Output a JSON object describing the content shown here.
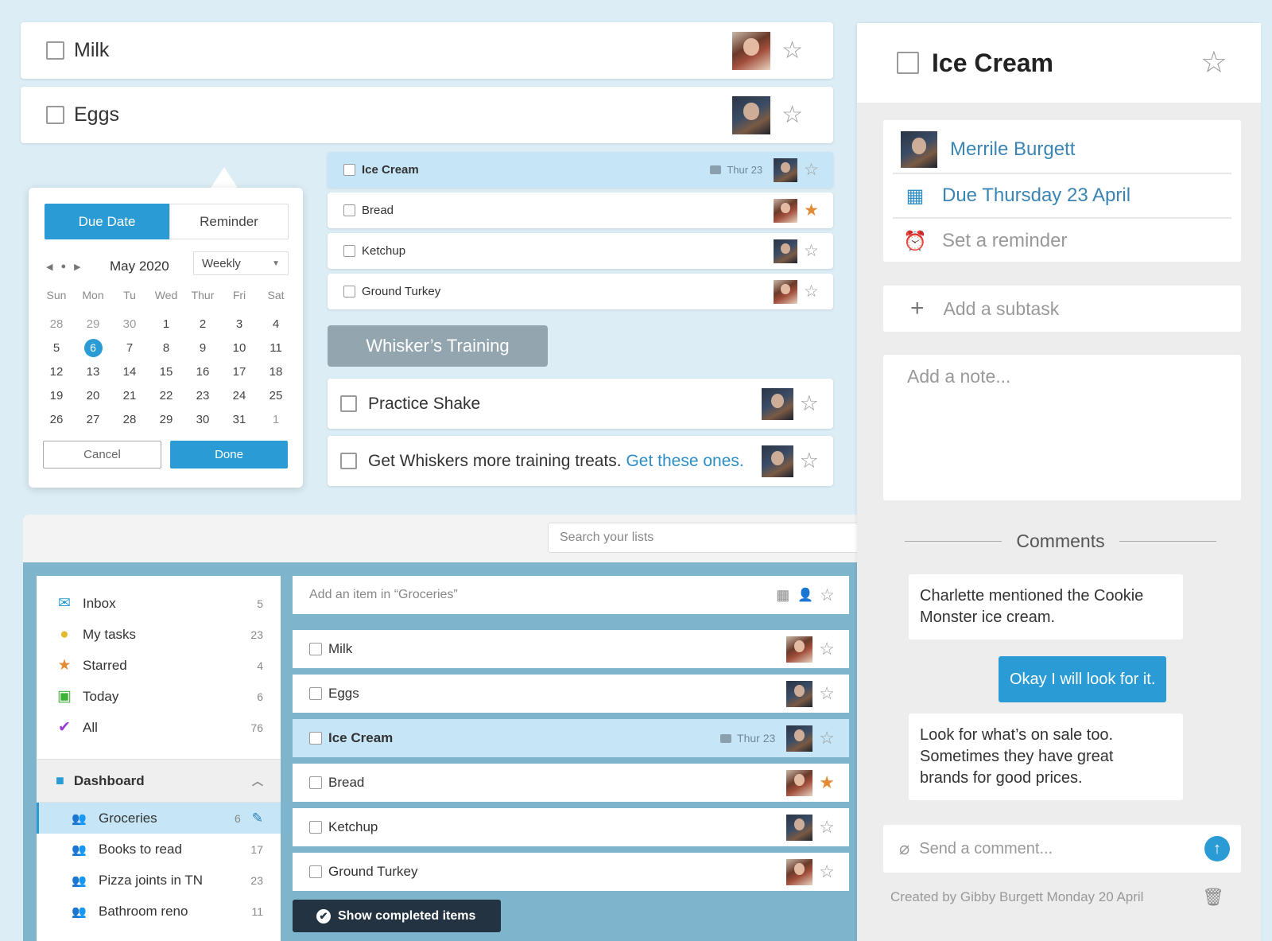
{
  "top_tasks": [
    {
      "label": "Milk",
      "assignee": "female",
      "starred": false
    },
    {
      "label": "Eggs",
      "assignee": "male",
      "starred": false
    }
  ],
  "mid_list": [
    {
      "label": "Ice Cream",
      "selected": true,
      "bold": true,
      "due": "Thur 23",
      "has_comment": true,
      "assignee": "male",
      "starred": false
    },
    {
      "label": "Bread",
      "assignee": "female",
      "starred": true
    },
    {
      "label": "Ketchup",
      "assignee": "male",
      "starred": false
    },
    {
      "label": "Ground Turkey",
      "assignee": "female",
      "starred": false
    }
  ],
  "calendar": {
    "tab_due": "Due Date",
    "tab_reminder": "Reminder",
    "month": "May 2020",
    "repeat": "Weekly",
    "weekdays": [
      "Sun",
      "Mon",
      "Tu",
      "Wed",
      "Thur",
      "Fri",
      "Sat"
    ],
    "weeks": [
      [
        "28",
        "29",
        "30",
        "1",
        "2",
        "3",
        "4"
      ],
      [
        "5",
        "6",
        "7",
        "8",
        "9",
        "10",
        "11"
      ],
      [
        "12",
        "13",
        "14",
        "15",
        "16",
        "17",
        "18"
      ],
      [
        "19",
        "20",
        "21",
        "22",
        "23",
        "24",
        "25"
      ],
      [
        "26",
        "27",
        "28",
        "29",
        "30",
        "31",
        "1"
      ]
    ],
    "selected_day": "6",
    "cancel_label": "Cancel",
    "done_label": "Done"
  },
  "whisker_list": {
    "title": "Whisker’s Training",
    "tasks": [
      {
        "label": "Practice Shake",
        "link": "",
        "assignee": "male"
      },
      {
        "label": "Get Whiskers more training treats.",
        "link": "Get these ones.",
        "assignee": "male"
      }
    ]
  },
  "app": {
    "search_placeholder": "Search your lists",
    "sidebar": [
      {
        "label": "Inbox",
        "count": "5",
        "icon": "inbox-icon",
        "glyph": "✉",
        "color": "#2a9bd4"
      },
      {
        "label": "My tasks",
        "count": "23",
        "icon": "person-icon",
        "glyph": "●",
        "color": "#e5b82e"
      },
      {
        "label": "Starred",
        "count": "4",
        "icon": "star-icon",
        "glyph": "★",
        "color": "#e38a35"
      },
      {
        "label": "Today",
        "count": "6",
        "icon": "calendar-icon",
        "glyph": "▣",
        "color": "#3fb337"
      },
      {
        "label": "All",
        "count": "76",
        "icon": "double-check-icon",
        "glyph": "✔",
        "color": "#9b3bd4"
      }
    ],
    "folder": "Dashboard",
    "lists": [
      {
        "label": "Groceries",
        "count": "6",
        "active": true
      },
      {
        "label": "Books to read",
        "count": "17"
      },
      {
        "label": "Pizza joints in TN",
        "count": "23"
      },
      {
        "label": "Bathroom reno",
        "count": "11"
      }
    ],
    "add_placeholder": "Add an item in “Groceries”",
    "items": [
      {
        "label": "Milk",
        "assignee": "female",
        "starred": false
      },
      {
        "label": "Eggs",
        "assignee": "male",
        "starred": false
      },
      {
        "label": "Ice Cream",
        "selected": true,
        "bold": true,
        "due": "Thur 23",
        "assignee": "male",
        "starred": false
      },
      {
        "label": "Bread",
        "assignee": "female",
        "starred": true
      },
      {
        "label": "Ketchup",
        "assignee": "male",
        "starred": false
      },
      {
        "label": "Ground Turkey",
        "assignee": "female",
        "starred": false
      }
    ],
    "show_completed": "Show completed items"
  },
  "detail": {
    "title": "Ice Cream",
    "assignee": "Merrile Burgett",
    "due": "Due Thursday 23 April",
    "reminder": "Set a reminder",
    "add_subtask": "Add a subtask",
    "note_placeholder": "Add a note...",
    "comments_heading": "Comments",
    "comments": [
      {
        "from": "other",
        "text": "Charlette mentioned the Cookie Monster ice cream."
      },
      {
        "from": "me",
        "text": "Okay I will look for it."
      },
      {
        "from": "other",
        "text": "Look for what’s on sale too. Sometimes they have great brands for good prices."
      }
    ],
    "send_placeholder": "Send a comment...",
    "created": "Created by Gibby Burgett Monday 20 April"
  },
  "colors": {
    "accent": "#2a9bd4",
    "star_on": "#e38a35",
    "selected_row": "#c6e6f7",
    "list_heading": "#93a6b0"
  }
}
